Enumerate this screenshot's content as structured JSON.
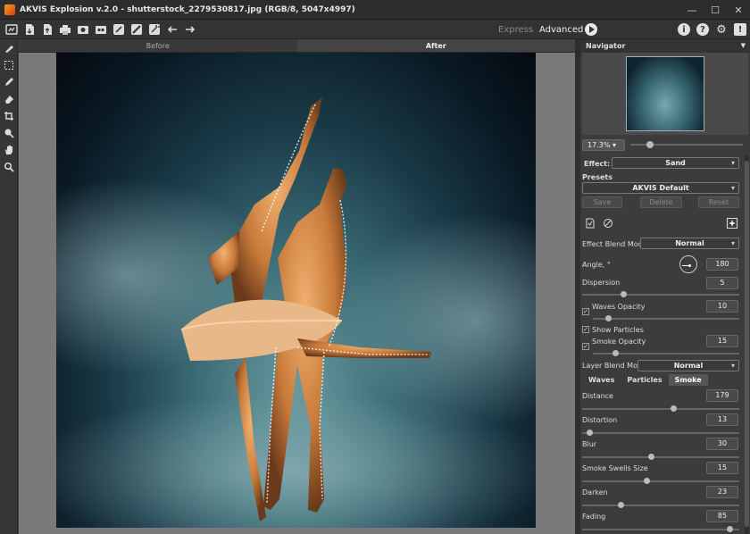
{
  "window": {
    "title": "AKVIS Explosion v.2.0 - shutterstock_2279530817.jpg (RGB/8, 5047x4997)",
    "controls": [
      "minimize",
      "maximize",
      "close"
    ]
  },
  "toolbar": {
    "left_icons": [
      "open-icon",
      "save-icon",
      "export-icon",
      "print-icon",
      "batch-icon",
      "share-icon",
      "brush-icon",
      "eraser-icon",
      "magic-icon",
      "undo-icon",
      "redo-icon"
    ],
    "express_label": "Express",
    "advanced_label": "Advanced",
    "right_icons": [
      "i",
      "?",
      "⚙",
      "!"
    ]
  },
  "left_tools": [
    "quick-selection-icon",
    "selection-icon",
    "pencil-icon",
    "eraser-icon",
    "crop-icon",
    "color-picker-icon",
    "hand-icon",
    "zoom-icon"
  ],
  "view_tabs": {
    "before": "Before",
    "after": "After"
  },
  "navigator": {
    "title": "Navigator",
    "zoom": "17.3%",
    "zoom_level": 0.15
  },
  "settings": {
    "effect_label": "Effect:",
    "effect_value": "Sand",
    "presets_label": "Presets",
    "preset_value": "AKVIS Default",
    "save_label": "Save",
    "delete_label": "Delete",
    "reset_label": "Reset",
    "blend_mode_label": "Effect Blend Mode",
    "blend_mode_value": "Normal",
    "angle_label": "Angle, °",
    "angle_value": "180",
    "dispersion_label": "Dispersion",
    "dispersion_value": "5",
    "waves_opacity_label": "Waves Opacity",
    "waves_opacity_value": "10",
    "show_particles_label": "Show Particles",
    "smoke_opacity_label": "Smoke Opacity",
    "smoke_opacity_value": "15",
    "layer_blend_label": "Layer Blend Mode",
    "layer_blend_value": "Normal",
    "tabs": [
      "Waves",
      "Particles",
      "Smoke"
    ],
    "active_tab": "Smoke",
    "distance_label": "Distance",
    "distance_value": "179",
    "distortion_label": "Distortion",
    "distortion_value": "13",
    "blur_label": "Blur",
    "blur_value": "30",
    "swells_label": "Smoke Swells Size",
    "swells_value": "15",
    "darken_label": "Darken",
    "darken_value": "23",
    "fading_label": "Fading",
    "fading_value": "85"
  }
}
